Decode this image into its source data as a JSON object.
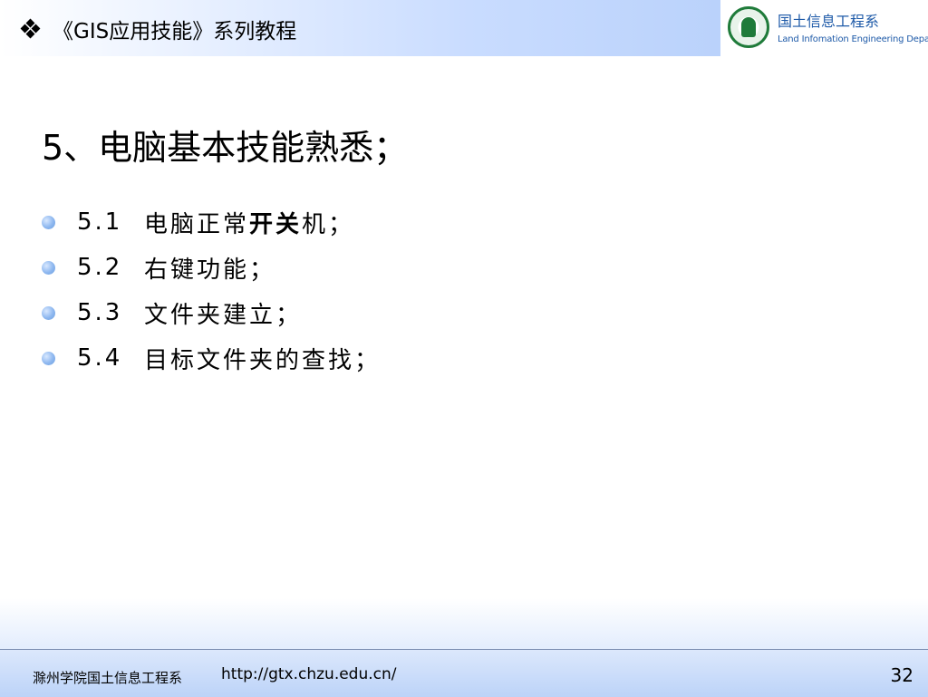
{
  "header": {
    "title": "《GIS应用技能》系列教程"
  },
  "logo": {
    "name_cn": "国土信息工程系",
    "name_en": "Land Infomation Engineering Department"
  },
  "slide": {
    "title": "5、电脑基本技能熟悉；",
    "bullets": [
      {
        "num": "5.1",
        "text_before": "电脑正常",
        "text_bold": "开关",
        "text_after": "机；"
      },
      {
        "num": "5.2",
        "text_before": "右键功能；",
        "text_bold": "",
        "text_after": ""
      },
      {
        "num": "5.3",
        "text_before": "文件夹建立；",
        "text_bold": "",
        "text_after": ""
      },
      {
        "num": "5.4",
        "text_before": "目标文件夹的查找；",
        "text_bold": "",
        "text_after": ""
      }
    ]
  },
  "footer": {
    "department": "滁州学院国土信息工程系",
    "url": "http://gtx.chzu.edu.cn/",
    "page_number": "32"
  },
  "colors": {
    "header_gradient_end": "#bad2fb",
    "logo_text": "#1e5aa8",
    "seal_green": "#1f7b3a",
    "bullet_dot": "#8db7ef"
  }
}
